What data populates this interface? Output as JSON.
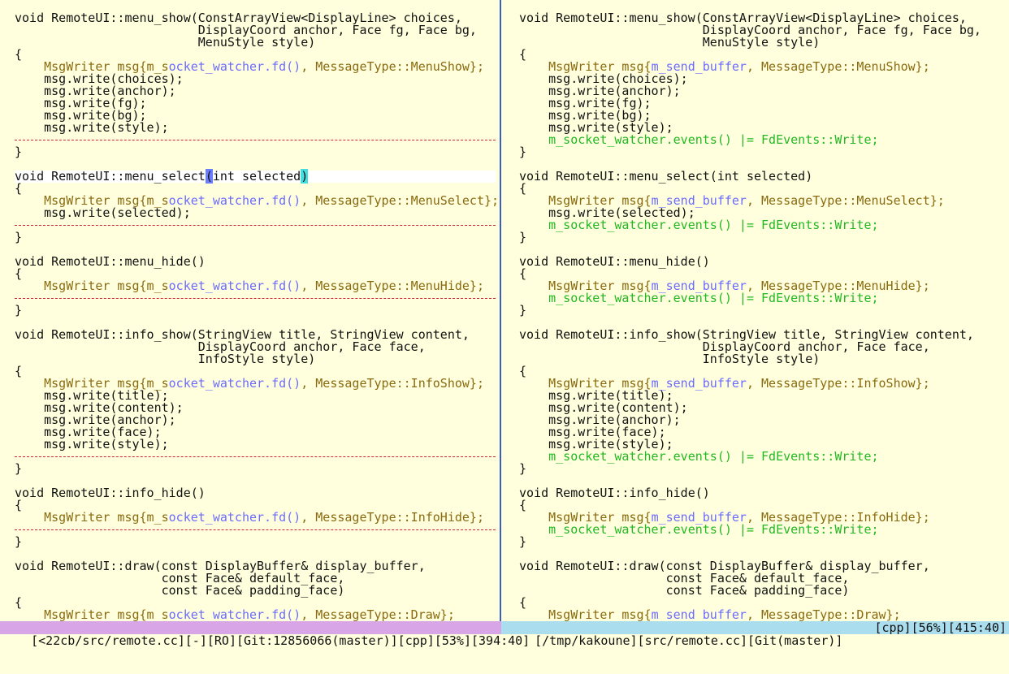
{
  "panes": [
    {
      "name": "left",
      "lines": [
        {
          "segs": [
            {
              "t": "void RemoteUI::menu_show(ConstArrayView<DisplayLine> choices,",
              "c": "t"
            }
          ]
        },
        {
          "segs": [
            {
              "t": "                         DisplayCoord anchor, Face fg, Face bg,",
              "c": "t"
            }
          ]
        },
        {
          "segs": [
            {
              "t": "                         MenuStyle style)",
              "c": "t"
            }
          ]
        },
        {
          "segs": [
            {
              "t": "{",
              "c": "t"
            }
          ]
        },
        {
          "segs": [
            {
              "t": "    MsgWriter msg{m_s",
              "c": "y"
            },
            {
              "t": "ocket_watcher.fd()",
              "c": "b"
            },
            {
              "t": ", MessageType::MenuShow};",
              "c": "y"
            }
          ]
        },
        {
          "segs": [
            {
              "t": "    msg.write(choices);",
              "c": "t"
            }
          ]
        },
        {
          "segs": [
            {
              "t": "    msg.write(anchor);",
              "c": "t"
            }
          ]
        },
        {
          "segs": [
            {
              "t": "    msg.write(fg);",
              "c": "t"
            }
          ]
        },
        {
          "segs": [
            {
              "t": "    msg.write(bg);",
              "c": "t"
            }
          ]
        },
        {
          "segs": [
            {
              "t": "    msg.write(style);",
              "c": "t"
            }
          ]
        },
        {
          "filler": true
        },
        {
          "segs": [
            {
              "t": "}",
              "c": "t"
            }
          ]
        },
        {
          "segs": []
        },
        {
          "sel": true,
          "segs": [
            {
              "t": "void RemoteUI::menu_select",
              "c": "t"
            },
            {
              "t": "(",
              "c": "cur"
            },
            {
              "t": "int selected",
              "c": "t"
            },
            {
              "t": ")",
              "c": "mt"
            }
          ]
        },
        {
          "segs": [
            {
              "t": "{",
              "c": "t"
            }
          ]
        },
        {
          "segs": [
            {
              "t": "    MsgWriter msg{m_s",
              "c": "y"
            },
            {
              "t": "ocket_watcher.fd()",
              "c": "b"
            },
            {
              "t": ", MessageType::MenuSelect};",
              "c": "y"
            }
          ]
        },
        {
          "segs": [
            {
              "t": "    msg.write(selected);",
              "c": "t"
            }
          ]
        },
        {
          "filler": true
        },
        {
          "segs": [
            {
              "t": "}",
              "c": "t"
            }
          ]
        },
        {
          "segs": []
        },
        {
          "segs": [
            {
              "t": "void RemoteUI::menu_hide()",
              "c": "t"
            }
          ]
        },
        {
          "segs": [
            {
              "t": "{",
              "c": "t"
            }
          ]
        },
        {
          "segs": [
            {
              "t": "    MsgWriter msg{m_s",
              "c": "y"
            },
            {
              "t": "ocket_watcher.fd()",
              "c": "b"
            },
            {
              "t": ", MessageType::MenuHide};",
              "c": "y"
            }
          ]
        },
        {
          "filler": true
        },
        {
          "segs": [
            {
              "t": "}",
              "c": "t"
            }
          ]
        },
        {
          "segs": []
        },
        {
          "segs": [
            {
              "t": "void RemoteUI::info_show(StringView title, StringView content,",
              "c": "t"
            }
          ]
        },
        {
          "segs": [
            {
              "t": "                         DisplayCoord anchor, Face face,",
              "c": "t"
            }
          ]
        },
        {
          "segs": [
            {
              "t": "                         InfoStyle style)",
              "c": "t"
            }
          ]
        },
        {
          "segs": [
            {
              "t": "{",
              "c": "t"
            }
          ]
        },
        {
          "segs": [
            {
              "t": "    MsgWriter msg{m_s",
              "c": "y"
            },
            {
              "t": "ocket_watcher.fd()",
              "c": "b"
            },
            {
              "t": ", MessageType::InfoShow};",
              "c": "y"
            }
          ]
        },
        {
          "segs": [
            {
              "t": "    msg.write(title);",
              "c": "t"
            }
          ]
        },
        {
          "segs": [
            {
              "t": "    msg.write(content);",
              "c": "t"
            }
          ]
        },
        {
          "segs": [
            {
              "t": "    msg.write(anchor);",
              "c": "t"
            }
          ]
        },
        {
          "segs": [
            {
              "t": "    msg.write(face);",
              "c": "t"
            }
          ]
        },
        {
          "segs": [
            {
              "t": "    msg.write(style);",
              "c": "t"
            }
          ]
        },
        {
          "filler": true
        },
        {
          "segs": [
            {
              "t": "}",
              "c": "t"
            }
          ]
        },
        {
          "segs": []
        },
        {
          "segs": [
            {
              "t": "void RemoteUI::info_hide()",
              "c": "t"
            }
          ]
        },
        {
          "segs": [
            {
              "t": "{",
              "c": "t"
            }
          ]
        },
        {
          "segs": [
            {
              "t": "    MsgWriter msg{m_s",
              "c": "y"
            },
            {
              "t": "ocket_watcher.fd()",
              "c": "b"
            },
            {
              "t": ", MessageType::InfoHide};",
              "c": "y"
            }
          ]
        },
        {
          "filler": true
        },
        {
          "segs": [
            {
              "t": "}",
              "c": "t"
            }
          ]
        },
        {
          "segs": []
        },
        {
          "segs": [
            {
              "t": "void RemoteUI::draw(const DisplayBuffer& display_buffer,",
              "c": "t"
            }
          ]
        },
        {
          "segs": [
            {
              "t": "                    const Face& default_face,",
              "c": "t"
            }
          ]
        },
        {
          "segs": [
            {
              "t": "                    const Face& padding_face)",
              "c": "t"
            }
          ]
        },
        {
          "segs": [
            {
              "t": "{",
              "c": "t"
            }
          ]
        },
        {
          "segs": [
            {
              "t": "    MsgWriter msg{m_s",
              "c": "y"
            },
            {
              "t": "ocket_watcher.fd()",
              "c": "b"
            },
            {
              "t": ", MessageType::Draw};",
              "c": "y"
            }
          ]
        }
      ]
    },
    {
      "name": "right",
      "lines": [
        {
          "segs": [
            {
              "t": "void RemoteUI::menu_show(ConstArrayView<DisplayLine> choices,",
              "c": "t"
            }
          ]
        },
        {
          "segs": [
            {
              "t": "                         DisplayCoord anchor, Face fg, Face bg,",
              "c": "t"
            }
          ]
        },
        {
          "segs": [
            {
              "t": "                         MenuStyle style)",
              "c": "t"
            }
          ]
        },
        {
          "segs": [
            {
              "t": "{",
              "c": "t"
            }
          ]
        },
        {
          "segs": [
            {
              "t": "    MsgWriter msg{",
              "c": "y"
            },
            {
              "t": "m_send_buffer",
              "c": "b"
            },
            {
              "t": ", MessageType::MenuShow};",
              "c": "y"
            }
          ]
        },
        {
          "segs": [
            {
              "t": "    msg.write(choices);",
              "c": "t"
            }
          ]
        },
        {
          "segs": [
            {
              "t": "    msg.write(anchor);",
              "c": "t"
            }
          ]
        },
        {
          "segs": [
            {
              "t": "    msg.write(fg);",
              "c": "t"
            }
          ]
        },
        {
          "segs": [
            {
              "t": "    msg.write(bg);",
              "c": "t"
            }
          ]
        },
        {
          "segs": [
            {
              "t": "    msg.write(style);",
              "c": "t"
            }
          ]
        },
        {
          "segs": [
            {
              "t": "    m_socket_watcher.events() |= FdEvents::Write;",
              "c": "g"
            }
          ]
        },
        {
          "segs": [
            {
              "t": "}",
              "c": "t"
            }
          ]
        },
        {
          "segs": []
        },
        {
          "segs": [
            {
              "t": "void RemoteUI::menu_select(int selected)",
              "c": "t"
            }
          ]
        },
        {
          "segs": [
            {
              "t": "{",
              "c": "t"
            }
          ]
        },
        {
          "segs": [
            {
              "t": "    MsgWriter msg{",
              "c": "y"
            },
            {
              "t": "m_send_buffer",
              "c": "b"
            },
            {
              "t": ", MessageType::MenuSelect};",
              "c": "y"
            }
          ]
        },
        {
          "segs": [
            {
              "t": "    msg.write(selected);",
              "c": "t"
            }
          ]
        },
        {
          "segs": [
            {
              "t": "    m_socket_watcher.events() |= FdEvents::Write;",
              "c": "g"
            }
          ]
        },
        {
          "segs": [
            {
              "t": "}",
              "c": "t"
            }
          ]
        },
        {
          "segs": []
        },
        {
          "segs": [
            {
              "t": "void RemoteUI::menu_hide()",
              "c": "t"
            }
          ]
        },
        {
          "segs": [
            {
              "t": "{",
              "c": "t"
            }
          ]
        },
        {
          "segs": [
            {
              "t": "    MsgWriter msg{",
              "c": "y"
            },
            {
              "t": "m_send_buffer",
              "c": "b"
            },
            {
              "t": ", MessageType::MenuHide};",
              "c": "y"
            }
          ]
        },
        {
          "segs": [
            {
              "t": "    m_socket_watcher.events() |= FdEvents::Write;",
              "c": "g"
            }
          ]
        },
        {
          "segs": [
            {
              "t": "}",
              "c": "t"
            }
          ]
        },
        {
          "segs": []
        },
        {
          "segs": [
            {
              "t": "void RemoteUI::info_show(StringView title, StringView content,",
              "c": "t"
            }
          ]
        },
        {
          "segs": [
            {
              "t": "                         DisplayCoord anchor, Face face,",
              "c": "t"
            }
          ]
        },
        {
          "segs": [
            {
              "t": "                         InfoStyle style)",
              "c": "t"
            }
          ]
        },
        {
          "segs": [
            {
              "t": "{",
              "c": "t"
            }
          ]
        },
        {
          "segs": [
            {
              "t": "    MsgWriter msg{",
              "c": "y"
            },
            {
              "t": "m_send_buffer",
              "c": "b"
            },
            {
              "t": ", MessageType::InfoShow};",
              "c": "y"
            }
          ]
        },
        {
          "segs": [
            {
              "t": "    msg.write(title);",
              "c": "t"
            }
          ]
        },
        {
          "segs": [
            {
              "t": "    msg.write(content);",
              "c": "t"
            }
          ]
        },
        {
          "segs": [
            {
              "t": "    msg.write(anchor);",
              "c": "t"
            }
          ]
        },
        {
          "segs": [
            {
              "t": "    msg.write(face);",
              "c": "t"
            }
          ]
        },
        {
          "segs": [
            {
              "t": "    msg.write(style);",
              "c": "t"
            }
          ]
        },
        {
          "segs": [
            {
              "t": "    m_socket_watcher.events() |= FdEvents::Write;",
              "c": "g"
            }
          ]
        },
        {
          "segs": [
            {
              "t": "}",
              "c": "t"
            }
          ]
        },
        {
          "segs": []
        },
        {
          "segs": [
            {
              "t": "void RemoteUI::info_hide()",
              "c": "t"
            }
          ]
        },
        {
          "segs": [
            {
              "t": "{",
              "c": "t"
            }
          ]
        },
        {
          "segs": [
            {
              "t": "    MsgWriter msg{",
              "c": "y"
            },
            {
              "t": "m_send_buffer",
              "c": "b"
            },
            {
              "t": ", MessageType::InfoHide};",
              "c": "y"
            }
          ]
        },
        {
          "segs": [
            {
              "t": "    m_socket_watcher.events() |= FdEvents::Write;",
              "c": "g"
            }
          ]
        },
        {
          "segs": [
            {
              "t": "}",
              "c": "t"
            }
          ]
        },
        {
          "segs": []
        },
        {
          "segs": [
            {
              "t": "void RemoteUI::draw(const DisplayBuffer& display_buffer,",
              "c": "t"
            }
          ]
        },
        {
          "segs": [
            {
              "t": "                    const Face& default_face,",
              "c": "t"
            }
          ]
        },
        {
          "segs": [
            {
              "t": "                    const Face& padding_face)",
              "c": "t"
            }
          ]
        },
        {
          "segs": [
            {
              "t": "{",
              "c": "t"
            }
          ]
        },
        {
          "segs": [
            {
              "t": "    MsgWriter msg{",
              "c": "y"
            },
            {
              "t": "m_send_buffer",
              "c": "b"
            },
            {
              "t": ", MessageType::Draw};",
              "c": "y"
            }
          ]
        }
      ]
    }
  ],
  "status": {
    "left": "[<22cb/src/remote.cc][-][RO][Git:12856066(master)][cpp][53%][394:40]",
    "right_path": "[/tmp/kakoune][src/remote.cc][Git(master)]",
    "right_pos": "[cpp][56%][415:40]"
  },
  "colors": {
    "background": "#ffffdd",
    "text": "#111111",
    "diff_yellow": "#8a6a10",
    "diff_blue": "#6b6bff",
    "added_green": "#22b822",
    "removed_red": "#cc2233",
    "cursor": "#6b7dff",
    "matching_paren": "#44dde0",
    "status_left_bg": "#d8a6e6",
    "status_right_bg": "#aaddee",
    "separator": "#3c5cc8"
  }
}
